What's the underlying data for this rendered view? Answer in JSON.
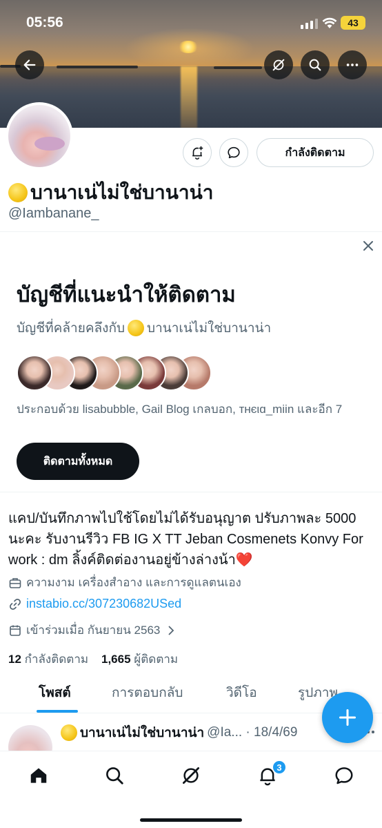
{
  "status_bar": {
    "time": "05:56",
    "battery": "43"
  },
  "profile": {
    "display_name": "บานาเน่ไม่ใช่บานาน่า",
    "handle": "@Iambanane_",
    "follow_state_label": "กำลังติดตาม"
  },
  "suggestions": {
    "title": "บัญชีที่แนะนำให้ติดตาม",
    "subtitle_prefix": "บัญชีที่คล้ายคลึงกับ",
    "subtitle_name": "บานาเน่ไม่ใช่บานาน่า",
    "members_text": "ประกอบด้วย lisabubble, Gail Blog เกลบอก, ᴛʜєιɑ_miin และอีก 7",
    "follow_all_label": "ติดตามทั้งหมด",
    "face_colors": [
      "#3b2a2a",
      "#e8c9c2",
      "#1e1a1a",
      "#c89a86",
      "#5a6a4a",
      "#7a3a3a",
      "#4a3c38",
      "#b67a6a"
    ]
  },
  "bio": {
    "text": "แคป/บันทึกภาพไปใช้โดยไม่ได้รับอนุญาต ปรับภาพละ 5000 นะคะ รับงานรีวิว FB IG X TT Jeban Cosmenets Konvy For work : dm ลิ้งค์ติดต่องานอยู่ข้างล่างน้า",
    "heart": "❤️",
    "category": "ความงาม เครื่องสำอาง และการดูแลตนเอง",
    "link": "instabio.cc/307230682USed",
    "joined": "เข้าร่วมเมื่อ กันยายน 2563"
  },
  "counts": {
    "following_value": "12",
    "following_label": "กำลังติดตาม",
    "followers_value": "1,665",
    "followers_label": "ผู้ติดตาม"
  },
  "tabs": [
    "โพสต์",
    "การตอบกลับ",
    "วิดีโอ",
    "รูปภาพ"
  ],
  "post": {
    "author": "บานาเน่ไม่ใช่บานาน่า",
    "meta": "@Ia... · 18/4/69"
  },
  "nav": {
    "notification_count": "3"
  },
  "colors": {
    "accent": "#1d9bf0",
    "text": "#0f1419",
    "secondary": "#536471"
  }
}
